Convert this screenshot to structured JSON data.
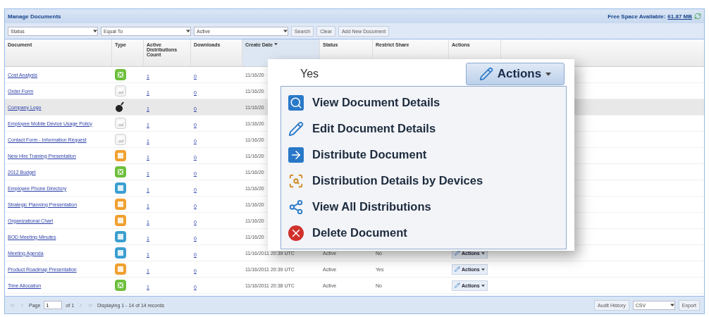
{
  "panel": {
    "title": "Manage Documents",
    "free_space_label": "Free Space Available:",
    "free_space_value": "61.87 MB"
  },
  "filter": {
    "field": "Status",
    "operator": "Equal To",
    "value": "Active",
    "buttons": [
      "Search",
      "Clear",
      "Add New Document"
    ]
  },
  "table": {
    "columns": [
      {
        "label": "Document",
        "sorted": false
      },
      {
        "label": "Type",
        "sorted": false
      },
      {
        "label": "Active Distributions Count",
        "sorted": false
      },
      {
        "label": "Downloads",
        "sorted": false
      },
      {
        "label": "Create Date",
        "sorted": true
      },
      {
        "label": "Status",
        "sorted": false
      },
      {
        "label": "Restrict Share",
        "sorted": false
      },
      {
        "label": "Actions",
        "sorted": false
      }
    ],
    "rows": [
      {
        "document": "Cost Analysis",
        "kind": "spreadsheet",
        "active": "1",
        "downloads": "0",
        "create_date": "11/16/20",
        "selected": false
      },
      {
        "document": "Order Form",
        "kind": "image",
        "active": "1",
        "downloads": "0",
        "create_date": "11/16/20",
        "selected": false
      },
      {
        "document": "Company Logo",
        "kind": "logo",
        "active": "1",
        "downloads": "0",
        "create_date": "11/16/20",
        "selected": true
      },
      {
        "document": "Employee Mobile Device Usage Policy",
        "kind": "image",
        "active": "1",
        "downloads": "0",
        "create_date": "11/16/20",
        "selected": false
      },
      {
        "document": "Contact Form - Information Request",
        "kind": "image",
        "active": "1",
        "downloads": "0",
        "create_date": "11/16/20",
        "selected": false
      },
      {
        "document": "New Hire Training Presentation",
        "kind": "presentation",
        "active": "1",
        "downloads": "0",
        "create_date": "11/16/20",
        "selected": false
      },
      {
        "document": "2012 Budget",
        "kind": "spreadsheet",
        "active": "1",
        "downloads": "0",
        "create_date": "11/16/20",
        "selected": false
      },
      {
        "document": "Employee Phone Directory",
        "kind": "text",
        "active": "1",
        "downloads": "0",
        "create_date": "11/16/20",
        "selected": false
      },
      {
        "document": "Strategic Planning Presentation",
        "kind": "presentation",
        "active": "1",
        "downloads": "0",
        "create_date": "11/16/20",
        "selected": false
      },
      {
        "document": "Organizational Chart",
        "kind": "presentation",
        "active": "1",
        "downloads": "0",
        "create_date": "11/16/20",
        "selected": false
      },
      {
        "document": "BOD Meeting Minutes",
        "kind": "text",
        "active": "1",
        "downloads": "0",
        "create_date": "11/16/20",
        "selected": false
      },
      {
        "document": "Meeting Agenda",
        "kind": "text",
        "active": "1",
        "downloads": "0",
        "create_date": "11/16/2011 20:39 UTC",
        "status": "Active",
        "restrict_share": "No",
        "actions": "Actions",
        "selected": false
      },
      {
        "document": "Product Roadmap Presentation",
        "kind": "presentation",
        "active": "1",
        "downloads": "0",
        "create_date": "11/16/2011 20:39 UTC",
        "status": "Active",
        "restrict_share": "Yes",
        "actions": "Actions",
        "selected": false
      },
      {
        "document": "Time Allocation",
        "kind": "spreadsheet",
        "active": "1",
        "downloads": "0",
        "create_date": "11/16/2011 20:38 UTC",
        "status": "Active",
        "restrict_share": "No",
        "actions": "Actions",
        "selected": false
      }
    ]
  },
  "popup": {
    "restrict_share": "Yes",
    "actions_button": "Actions",
    "menu": [
      {
        "label": "View Document Details",
        "kind": "view"
      },
      {
        "label": "Edit Document Details",
        "kind": "edit"
      },
      {
        "label": "Distribute Document",
        "kind": "distribute"
      },
      {
        "label": "Distribution Details by Devices",
        "kind": "devices"
      },
      {
        "label": "View All Distributions",
        "kind": "all"
      },
      {
        "label": "Delete Document",
        "kind": "delete"
      }
    ]
  },
  "pager": {
    "page_label": "Page",
    "page": "1",
    "of": "of 1",
    "summary": "Displaying 1 - 14 of 14 records"
  },
  "export": {
    "audit_button": "Audit History",
    "format": "CSV",
    "export_button": "Export"
  }
}
